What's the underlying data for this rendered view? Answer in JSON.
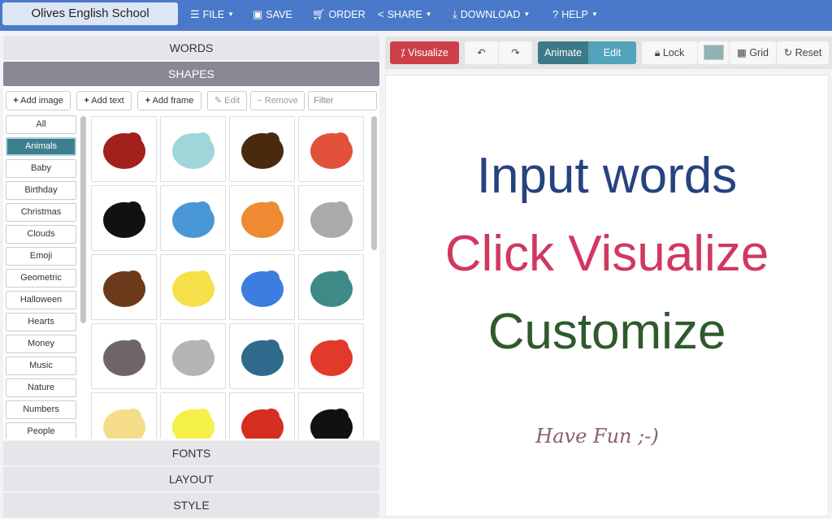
{
  "topbar": {
    "title": "Olives English School",
    "menus": [
      {
        "label": "FILE",
        "icon": "menu-icon",
        "dropdown": true
      },
      {
        "label": "SAVE",
        "icon": "save-icon",
        "dropdown": false
      },
      {
        "label": "ORDER",
        "icon": "cart-icon",
        "dropdown": false
      },
      {
        "label": "SHARE",
        "icon": "share-icon",
        "dropdown": true
      },
      {
        "label": "DOWNLOAD",
        "icon": "download-icon",
        "dropdown": true
      },
      {
        "label": "HELP",
        "icon": "help-icon",
        "dropdown": true
      }
    ]
  },
  "left": {
    "sections": {
      "words": "WORDS",
      "shapes": "SHAPES",
      "fonts": "FONTS",
      "layout": "LAYOUT",
      "style": "STYLE"
    },
    "toolbar": {
      "add_image": "Add image",
      "add_text": "Add text",
      "add_frame": "Add frame",
      "edit": "Edit",
      "remove": "Remove",
      "filter_placeholder": "Filter"
    },
    "categories": [
      "All",
      "Animals",
      "Baby",
      "Birthday",
      "Christmas",
      "Clouds",
      "Emoji",
      "Geometric",
      "Halloween",
      "Hearts",
      "Money",
      "Music",
      "Nature",
      "Numbers",
      "People"
    ],
    "selected_category": "Animals",
    "shapes": [
      {
        "icon": "heart-pets-icon",
        "color": "#a3201c"
      },
      {
        "icon": "dog-cat-icon",
        "color": "#9fd6d9"
      },
      {
        "icon": "dog-cat-silhouette-icon",
        "color": "#4a2a0e"
      },
      {
        "icon": "turkey-icon",
        "color": "#e2513a"
      },
      {
        "icon": "panda-icon",
        "color": "#111111"
      },
      {
        "icon": "bluebird-icon",
        "color": "#4a97d6"
      },
      {
        "icon": "flying-bird-icon",
        "color": "#ee8a32"
      },
      {
        "icon": "cat-outline-icon",
        "color": "#aaaaaa"
      },
      {
        "icon": "monkey-icon",
        "color": "#6b3a1a"
      },
      {
        "icon": "giraffe-icon",
        "color": "#f5e04a"
      },
      {
        "icon": "blue-bird-icon",
        "color": "#3b7de0"
      },
      {
        "icon": "dove-icon",
        "color": "#3f8a86"
      },
      {
        "icon": "hedgehog-icon",
        "color": "#6f6566"
      },
      {
        "icon": "whale-icon",
        "color": "#b5b5b5"
      },
      {
        "icon": "penguin-icon",
        "color": "#2f6a8c"
      },
      {
        "icon": "crab-icon",
        "color": "#e23a2a"
      },
      {
        "icon": "chick-icon",
        "color": "#f5dc8a"
      },
      {
        "icon": "butterfly-icon",
        "color": "#f5f04a"
      },
      {
        "icon": "rooster-icon",
        "color": "#d62e1f"
      },
      {
        "icon": "eagle-icon",
        "color": "#111111"
      }
    ]
  },
  "right": {
    "toolbar": {
      "visualize": "Visualize",
      "animate": "Animate",
      "edit": "Edit",
      "lock": "Lock",
      "grid": "Grid",
      "reset": "Reset",
      "color_swatch": "#8fb3b3"
    },
    "canvas": {
      "lines": [
        {
          "text": "Input words",
          "color": "#27427f"
        },
        {
          "text": "Click Visualize",
          "color": "#d1385f"
        },
        {
          "text": "Customize",
          "color": "#2f5a2b"
        },
        {
          "text": "Have Fun ;-)",
          "color": "#8a5f6f"
        }
      ]
    }
  }
}
